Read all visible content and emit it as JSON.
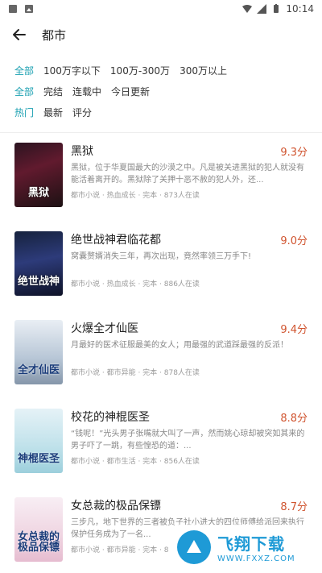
{
  "status_bar": {
    "time": "10:14",
    "icons": [
      "notification-icon",
      "photo-icon",
      "wifi-icon",
      "signal-icon",
      "battery-icon"
    ]
  },
  "app_bar": {
    "title": "都市",
    "back_icon": "arrow-left-icon"
  },
  "filters": {
    "word_count": [
      "全部",
      "100万字以下",
      "100万-300万",
      "300万以上"
    ],
    "status": [
      "全部",
      "完结",
      "连载中",
      "今日更新"
    ],
    "sort": [
      "热门",
      "最新",
      "评分"
    ],
    "accent_color": "#1da1b2"
  },
  "books": [
    {
      "title": "黑狱",
      "score": "9.3分",
      "desc": "黑狱，位于华夏国最大的沙漠之中。凡是被关进黑狱的犯人就没有能活着离开的。黑狱除了关押十恶不赦的犯人外，还...",
      "meta": "都市小说 · 热血成长 · 完本 · 873人在读",
      "cover_text": "黑狱"
    },
    {
      "title": "绝世战神君临花都",
      "score": "9.0分",
      "desc": "窝囊赘婿消失三年，再次出现，竟然率领三万手下!",
      "meta": "都市小说 · 热血成长 · 完本 · 886人在读",
      "cover_text": "绝世战神"
    },
    {
      "title": "火爆全才仙医",
      "score": "9.4分",
      "desc": "月最好的医术征服最美的女人；用最强的武道踩最强的反派！",
      "meta": "都市小说 · 都市异能 · 完本 · 878人在读",
      "cover_text": "全才仙医"
    },
    {
      "title": "校花的神棍医圣",
      "score": "8.8分",
      "desc": "“钱呢！”光头男子张嘴就大叫了一声，然而姚心琼却被突如其来的男子吓了一跳，有些惶恐的道：...",
      "meta": "都市小说 · 都市生活 · 完本 · 856人在读",
      "cover_text": "神棍医圣"
    },
    {
      "title": "女总裁的极品保镖",
      "score": "8.7分",
      "desc": "三步凡，地下世界的三者被负子社小进大的四位师傅给派回来执行保护任务成为了一名...",
      "meta": "都市小说 · 都市异能 · 完本 · 8",
      "cover_text": "女总裁的极品保镖"
    }
  ],
  "score_color": "#d0542f",
  "watermark": {
    "main": "飞翔下载",
    "url": "WWW.FXXZ.COM"
  }
}
